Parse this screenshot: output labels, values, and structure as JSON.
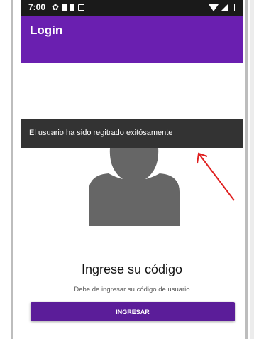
{
  "status_bar": {
    "time": "7:00",
    "icons_left": [
      "gear-icon",
      "notification-icon",
      "notification-icon",
      "sd-card-icon"
    ],
    "icons_right": [
      "wifi-icon",
      "signal-icon",
      "battery-icon"
    ]
  },
  "app_bar": {
    "title": "Login",
    "color": "#6a1fb0"
  },
  "snackbar": {
    "message": "El usuario ha sido regitrado exitósamente",
    "color": "#333333"
  },
  "avatar": {
    "icon": "person-icon",
    "color": "#666666"
  },
  "annotation": {
    "icon": "red-arrow-icon",
    "color": "#e02020"
  },
  "main": {
    "heading": "Ingrese su código",
    "subtitle": "Debe de ingresar su código de usuario",
    "button_label": "INGRESAR",
    "button_color": "#5b1d99"
  }
}
